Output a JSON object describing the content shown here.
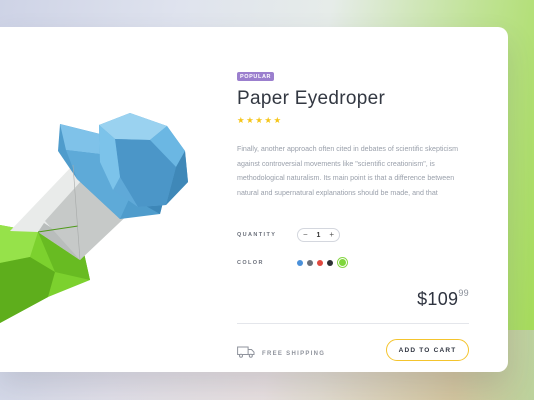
{
  "product": {
    "badge": "POPULAR",
    "title": "Paper Eyedroper",
    "rating": 5,
    "stars": [
      "★",
      "★",
      "★",
      "★",
      "★"
    ],
    "description": "Finally, another approach often cited in debates of scientific skepticism against controversial movements like \"scientific creationism\", is methodological naturalism. Its main point is that a difference between natural and supernatural explanations should be made, and that",
    "image_icon": "paper-eyedropper-image"
  },
  "quantity": {
    "label": "QUANTITY",
    "minus": "−",
    "value": "1",
    "plus": "+"
  },
  "color": {
    "label": "COLOR",
    "options": [
      "#4a90d9",
      "#6b6f78",
      "#e0483f",
      "#2c2f35",
      "#7ed63a"
    ],
    "selected_index": 4
  },
  "price": {
    "main": "$109",
    "cents": "99"
  },
  "shipping": {
    "icon": "truck-icon",
    "label": "FREE SHIPPING"
  },
  "cart": {
    "label": "ADD TO CART"
  },
  "colors": {
    "badge": "#9b7fce",
    "star": "#f5c518",
    "cart_border": "#f4c42d",
    "accent_green": "#7ed63a"
  }
}
